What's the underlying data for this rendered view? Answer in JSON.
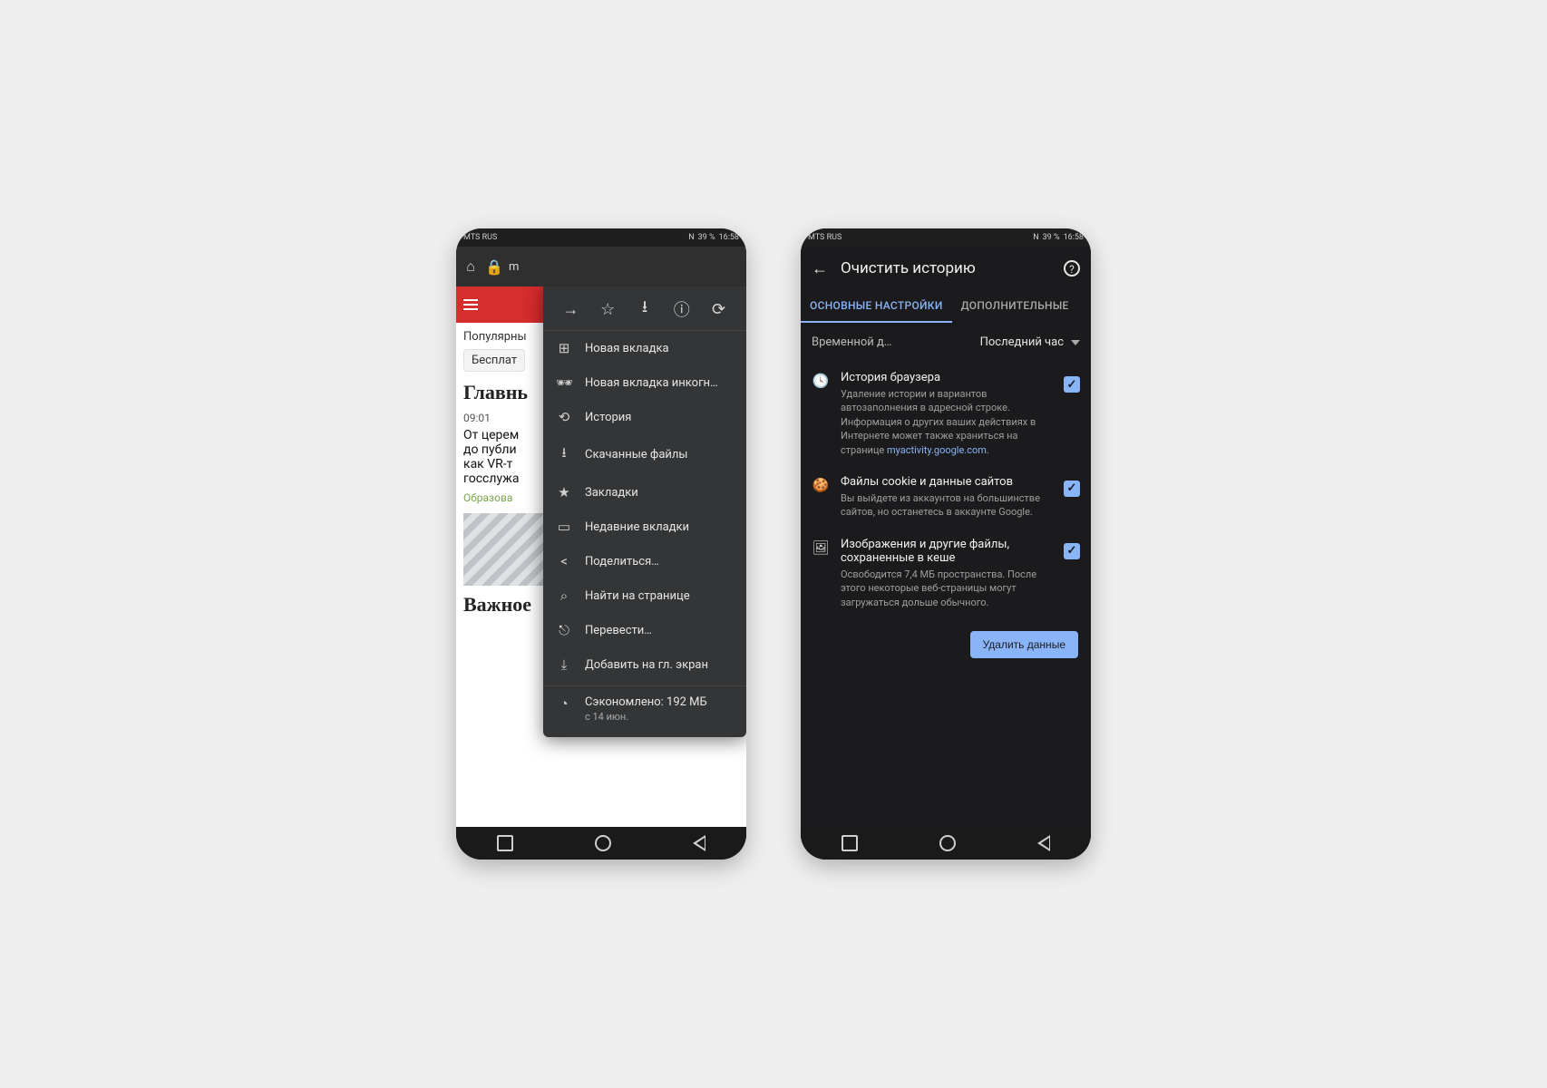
{
  "status": {
    "carrier": "MTS RUS",
    "battery": "39 %",
    "time": "16:58",
    "nfc": "N"
  },
  "screen1": {
    "url_fragment": "m",
    "chips": "Популярны",
    "chip": "Бесплат",
    "headline": "Главнь",
    "article_time": "09:01",
    "article_text": "От церем\nдо публи\nкак VR-т\nгосслужа",
    "tag": "Образова",
    "section": "Важное"
  },
  "menu_top": {
    "forward": "→",
    "star": "☆",
    "download": "⭳",
    "info": "ⓘ",
    "reload": "⟳"
  },
  "menu": [
    {
      "icon": "⊞",
      "label": "Новая вкладка"
    },
    {
      "icon": "🕶",
      "label": "Новая вкладка инкогн…"
    },
    {
      "icon": "⟲",
      "label": "История"
    },
    {
      "icon": "⭳",
      "label": "Скачанные файлы"
    },
    {
      "icon": "★",
      "label": "Закладки"
    },
    {
      "icon": "▭",
      "label": "Недавние вкладки"
    },
    {
      "icon": "<",
      "label": "Поделиться…"
    },
    {
      "icon": "⌕",
      "label": "Найти на странице"
    },
    {
      "icon": "⎋",
      "label": "Перевести…"
    },
    {
      "icon": "⤓",
      "label": "Добавить на гл. экран"
    }
  ],
  "menu_saved": {
    "icon": "◔",
    "title": "Сэкономлено: 192 МБ",
    "sub": "с 14 июн."
  },
  "screen2": {
    "title": "Очистить историю",
    "tabs": {
      "active": "ОСНОВНЫЕ НАСТРОЙКИ",
      "other": "ДОПОЛНИТЕЛЬНЫЕ"
    },
    "time_label": "Временной д…",
    "time_value": "Последний час",
    "opts": [
      {
        "icon": "🕓",
        "title": "История браузера",
        "desc": "Удаление истории и вариантов автозаполнения в адресной строке. Информация о других ваших действиях в Интернете может также храниться на странице ",
        "link": "myactivity.google.com",
        "checked": true
      },
      {
        "icon": "🍪",
        "title": "Файлы cookie и данные сайтов",
        "desc": "Вы выйдете из аккаунтов на большинстве сайтов, но останетесь в аккаунте Google.",
        "checked": true
      },
      {
        "icon": "🖼",
        "title": "Изображения и другие файлы, сохраненные в кеше",
        "desc": "Освободится 7,4 МБ пространства. После этого некоторые веб-страницы могут загружаться дольше обычного.",
        "checked": true
      }
    ],
    "button": "Удалить данные"
  }
}
